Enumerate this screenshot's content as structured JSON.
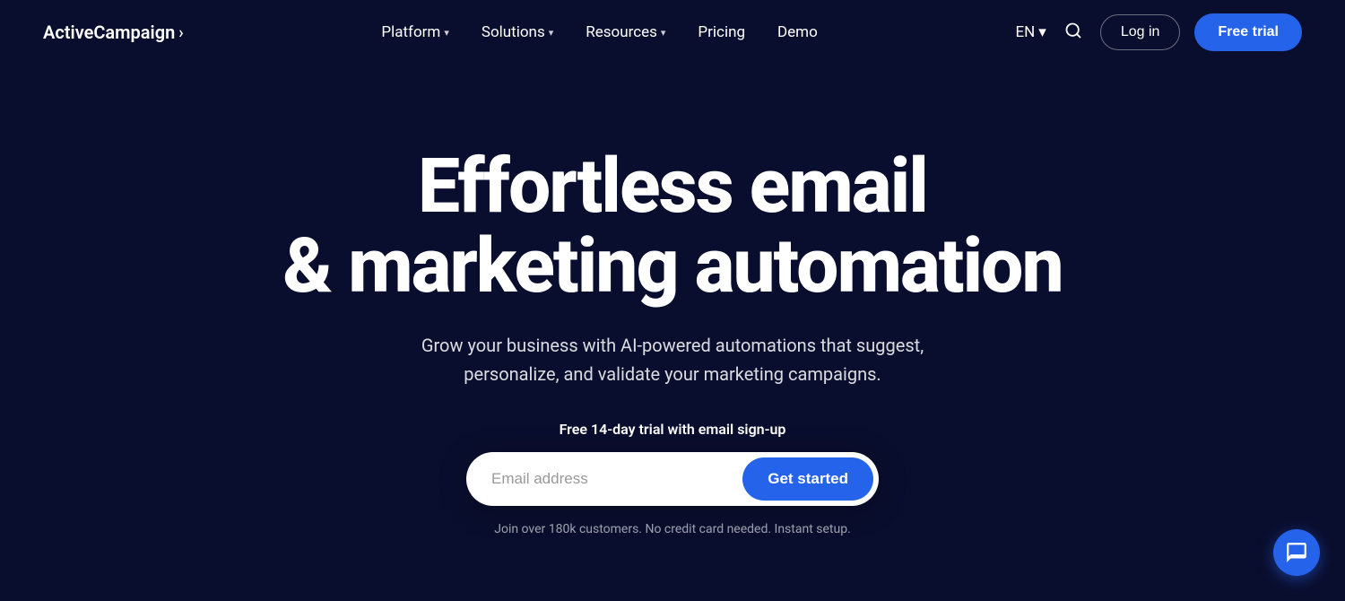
{
  "brand": {
    "logo_text": "ActiveCampaign",
    "logo_arrow": "›"
  },
  "nav": {
    "links": [
      {
        "label": "Platform",
        "has_dropdown": true
      },
      {
        "label": "Solutions",
        "has_dropdown": true
      },
      {
        "label": "Resources",
        "has_dropdown": true
      },
      {
        "label": "Pricing",
        "has_dropdown": false
      },
      {
        "label": "Demo",
        "has_dropdown": false
      }
    ],
    "lang": "EN",
    "login_label": "Log in",
    "free_trial_label": "Free trial"
  },
  "hero": {
    "title_line1": "Effortless email",
    "title_line2": "& marketing automation",
    "subtitle": "Grow your business with AI-powered automations that suggest, personalize, and validate your marketing campaigns.",
    "trial_label": "Free 14-day trial with email sign-up",
    "input_placeholder": "Email address",
    "cta_label": "Get started",
    "footnote": "Join over 180k customers. No credit card needed. Instant setup."
  }
}
